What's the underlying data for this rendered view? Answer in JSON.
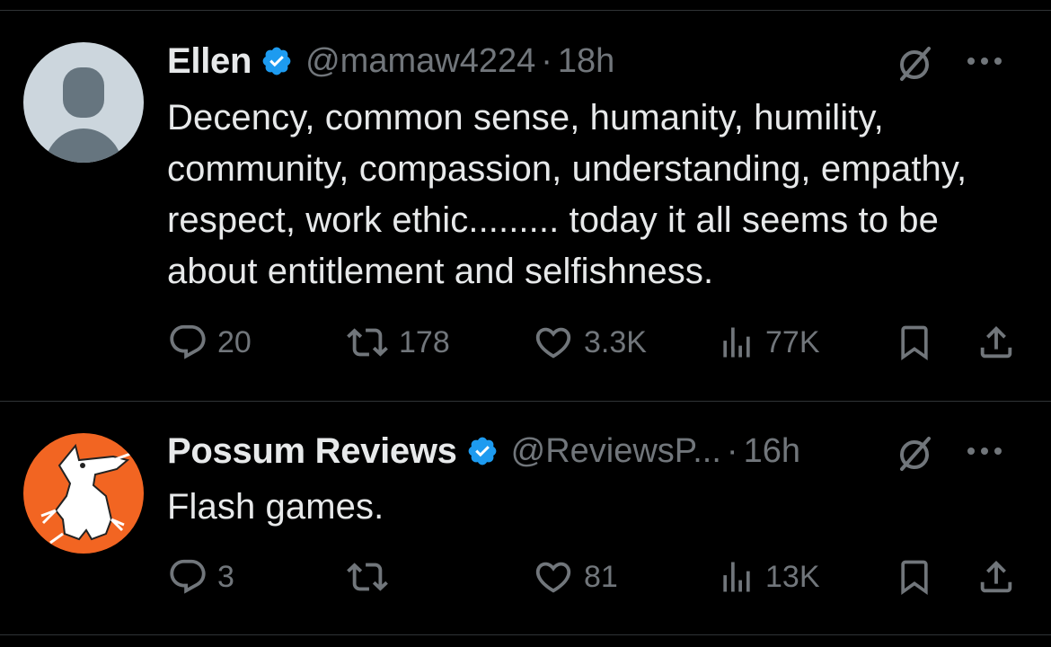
{
  "tweets": [
    {
      "display_name": "Ellen",
      "handle": "@mamaw4224",
      "separator": "·",
      "time": "18h",
      "text": "Decency, common sense, humanity, humility, community, compassion, understanding, empathy, respect, work ethic......... today it all seems to be about entitlement and selfishness.",
      "replies": "20",
      "retweets": "178",
      "likes": "3.3K",
      "views": "77K"
    },
    {
      "display_name": "Possum Reviews",
      "handle": "@ReviewsP...",
      "separator": "·",
      "time": "16h",
      "text": "Flash games.",
      "replies": "3",
      "retweets": "",
      "likes": "81",
      "views": "13K"
    }
  ],
  "icons": {
    "verified": "verified-badge-icon",
    "grok": "grok-icon",
    "more": "more-icon",
    "reply": "reply-icon",
    "retweet": "retweet-icon",
    "like": "heart-icon",
    "views": "views-icon",
    "bookmark": "bookmark-icon",
    "share": "share-icon"
  },
  "colors": {
    "background": "#000000",
    "text": "#e7e9ea",
    "secondary": "#71767b",
    "verified": "#1d9bf0",
    "divider": "#2f3336",
    "avatar_default": "#ccd6dd",
    "avatar_orange": "#f26522"
  }
}
